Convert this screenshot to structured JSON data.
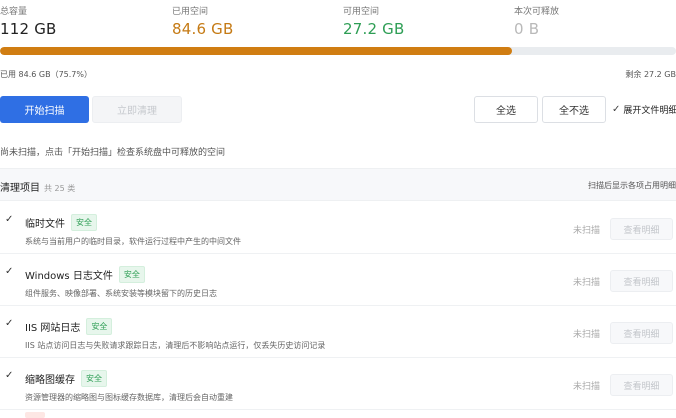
{
  "stats": [
    {
      "label": "总容量",
      "value": "112 GB"
    },
    {
      "label": "已用空间",
      "value": "84.6 GB"
    },
    {
      "label": "可用空间",
      "value": "27.2 GB"
    },
    {
      "label": "本次可释放",
      "value": "0 B"
    }
  ],
  "usage": {
    "used_percent": 75.7,
    "used_text": "已用 84.6 GB（75.7%）",
    "remaining_text": "剩余 27.2 GB",
    "bar_color": "#d07d12"
  },
  "toolbar": {
    "scan_label": "开始扫描",
    "clean_label": "立即清理",
    "select_all_label": "全选",
    "select_none_label": "全不选",
    "expand_label": "展开文件明细"
  },
  "hint": "尚未扫描，点击「开始扫描」检查系统盘中可释放的空间",
  "section": {
    "title": "清理项目",
    "count": "共 25 类",
    "note": "扫描后显示各项占用明细"
  },
  "items": [
    {
      "name": "临时文件",
      "badge": "安全",
      "desc": "系统与当前用户的临时目录，软件运行过程中产生的中间文件",
      "status": "未扫描",
      "detail_label": "查看明细"
    },
    {
      "name": "Windows 日志文件",
      "badge": "安全",
      "desc": "组件服务、映像部署、系统安装等模块留下的历史日志",
      "status": "未扫描",
      "detail_label": "查看明细"
    },
    {
      "name": "IIS 网站日志",
      "badge": "安全",
      "desc": "IIS 站点访问日志与失败请求跟踪日志，清理后不影响站点运行，仅丢失历史访问记录",
      "status": "未扫描",
      "detail_label": "查看明细"
    },
    {
      "name": "缩略图缓存",
      "badge": "安全",
      "desc": "资源管理器的缩略图与图标缓存数据库，清理后会自动重建",
      "status": "未扫描",
      "detail_label": "查看明细"
    }
  ],
  "icons": {
    "check": "check-icon"
  }
}
